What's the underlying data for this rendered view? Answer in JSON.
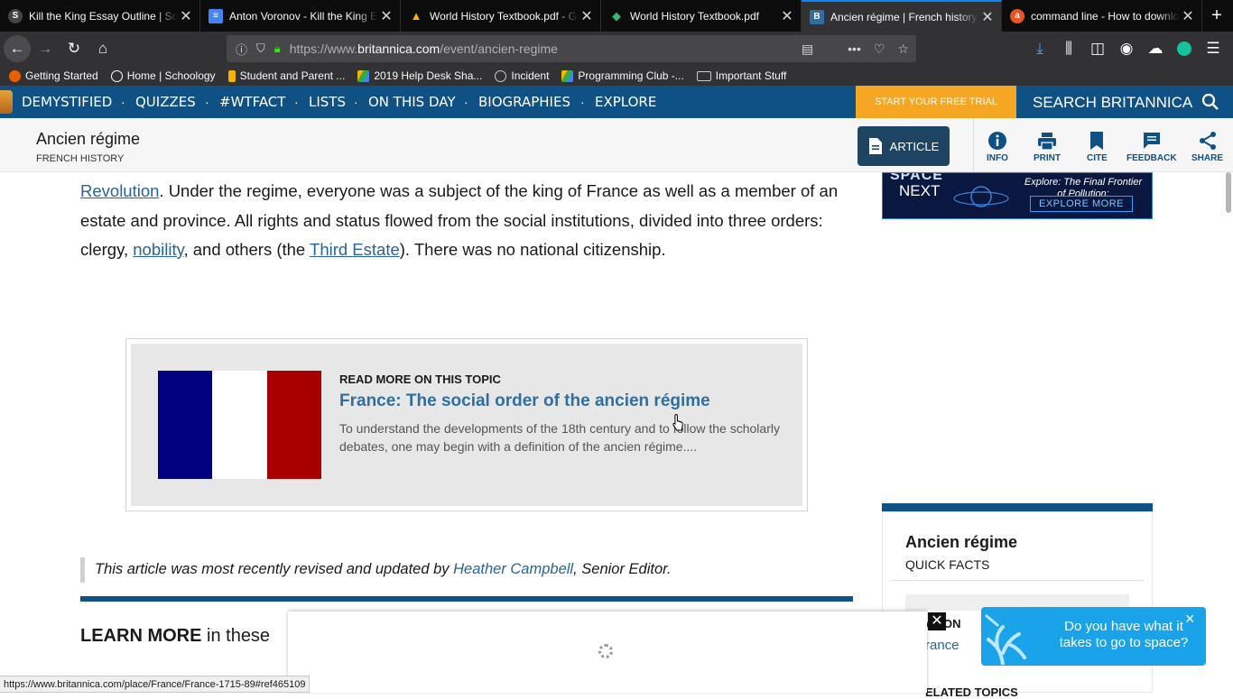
{
  "browser": {
    "tabs": [
      {
        "title": "Kill the King Essay Outline | Schoology",
        "icon": "schoology-icon",
        "color": "#2a2a2e",
        "glyph": "S"
      },
      {
        "title": "Anton Voronov - Kill the King Essay",
        "icon": "google-docs-icon",
        "color": "#4285f4",
        "glyph": "≡"
      },
      {
        "title": "World History Textbook.pdf - Google Drive",
        "icon": "google-drive-icon",
        "color": "#f4b400",
        "glyph": "▲"
      },
      {
        "title": "World History Textbook.pdf",
        "icon": "pdf-icon",
        "color": "#3cb371",
        "glyph": "◆"
      },
      {
        "title": "Ancien régime | French history | Britannica",
        "icon": "britannica-icon",
        "color": "#2f6f9f",
        "glyph": "B"
      },
      {
        "title": "command line - How to download",
        "icon": "askubuntu-icon",
        "color": "#e95420",
        "glyph": "a"
      }
    ],
    "url_prefix": "https://www.",
    "url_host": "britannica.com",
    "url_path": "/event/ancien-regime",
    "bookmarks": [
      {
        "label": "Getting Started",
        "color": "#e66000"
      },
      {
        "label": "Home | Schoology",
        "color": "#2a2a2e"
      },
      {
        "label": "Student and Parent ...",
        "color": "#f4b400"
      },
      {
        "label": "2019 Help Desk Sha...",
        "color": "#34a853"
      },
      {
        "label": "Incident",
        "color": "#888888"
      },
      {
        "label": "Programming Club -...",
        "color": "#34a853"
      },
      {
        "label": "Important Stuff",
        "color": "#bbbbbb"
      }
    ],
    "status_url": "https://www.britannica.com/place/France/France-1715-89#ref465109"
  },
  "site_nav": {
    "items": [
      "DEMYSTIFIED",
      "QUIZZES",
      "#WTFACT",
      "LISTS",
      "ON THIS DAY",
      "BIOGRAPHIES",
      "EXPLORE"
    ],
    "trial_label": "START YOUR FREE TRIAL",
    "search_label": "SEARCH BRITANNICA"
  },
  "article_header": {
    "title": "Ancien régime",
    "subtitle": "FRENCH HISTORY",
    "article_button": "ARTICLE",
    "actions": [
      "INFO",
      "PRINT",
      "CITE",
      "FEEDBACK",
      "SHARE"
    ]
  },
  "article": {
    "para_p1": "Revolution",
    "para_p2": ". Under the regime, everyone was a subject of the king of France as well as a member of an estate and province. All rights and status flowed from the social institutions, divided into three orders: clergy, ",
    "para_link2": "nobility",
    "para_p3": ", and others (the ",
    "para_link3": "Third Estate",
    "para_p4": "). There was no national citizenship.",
    "read_more_label": "READ MORE ON THIS TOPIC",
    "read_more_title": "France: The social order of the ancien régime",
    "read_more_desc": "To understand the developments of the 18th century and to follow the scholarly debates, one may begin with a definition of the ancien régime....",
    "revised_prefix": "This article was most recently revised and updated by ",
    "revised_author": "Heather Campbell",
    "revised_suffix": ", Senior Editor.",
    "learn_more_bold": "LEARN MORE",
    "learn_more_rest": " in these"
  },
  "sidebar": {
    "ad_space": "SPACE",
    "ad_next": "NEXT",
    "ad_text": "Explore: The Final Frontier of Pollution:",
    "ad_button": "EXPLORE MORE",
    "quick_facts_title": "Ancien régime",
    "quick_facts_sub": "QUICK FACTS",
    "location_label": "ATION",
    "location_value": "rance",
    "related_label": "ELATED TOPICS"
  },
  "popup": {
    "text": "Do you have what it takes to go to space?",
    "close": "×"
  },
  "colors": {
    "brand_blue": "#0f5185",
    "trial_orange": "#f5a623",
    "link_blue": "#2a6496",
    "flag_blue": "#000080",
    "flag_red": "#a80000"
  }
}
